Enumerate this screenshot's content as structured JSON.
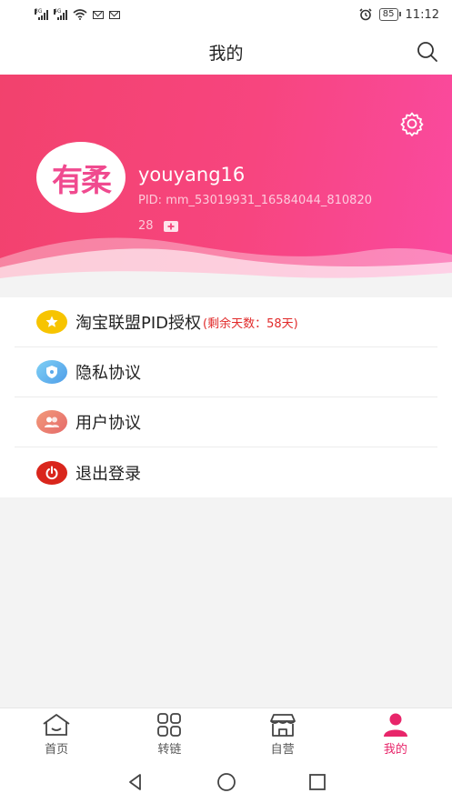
{
  "status_bar": {
    "time": "11:12",
    "battery": "85",
    "sig1_tag": "3G",
    "sig2_tag": "4G",
    "icons": [
      "signal-3g-icon",
      "signal-4g-icon",
      "wifi-icon",
      "mail-icon",
      "mail-icon",
      "alarm-icon",
      "battery-icon"
    ]
  },
  "header": {
    "title": "我的",
    "search_icon": "search-icon"
  },
  "profile": {
    "avatar_text": "有柔",
    "username": "youyang16",
    "pid_line1": "PID: mm_53019931_16584044_810820",
    "pid_line2": "28",
    "settings_icon": "gear-icon",
    "copy_icon": "copy-icon",
    "gradient_colors": [
      "#f2426d",
      "#fa4aa0"
    ]
  },
  "menu": {
    "items": [
      {
        "label": "淘宝联盟PID授权",
        "note": "(剩余天数：58天)",
        "icon": "star-badge-icon"
      },
      {
        "label": "隐私协议",
        "note": "",
        "icon": "shield-icon"
      },
      {
        "label": "用户协议",
        "note": "",
        "icon": "users-icon"
      },
      {
        "label": "退出登录",
        "note": "",
        "icon": "power-icon"
      }
    ]
  },
  "tabbar": {
    "accent_color": "#e8256a",
    "tabs": [
      {
        "label": "首页",
        "icon": "home-icon"
      },
      {
        "label": "转链",
        "icon": "grid-icon"
      },
      {
        "label": "自营",
        "icon": "shop-icon"
      },
      {
        "label": "我的",
        "icon": "person-icon"
      }
    ]
  }
}
